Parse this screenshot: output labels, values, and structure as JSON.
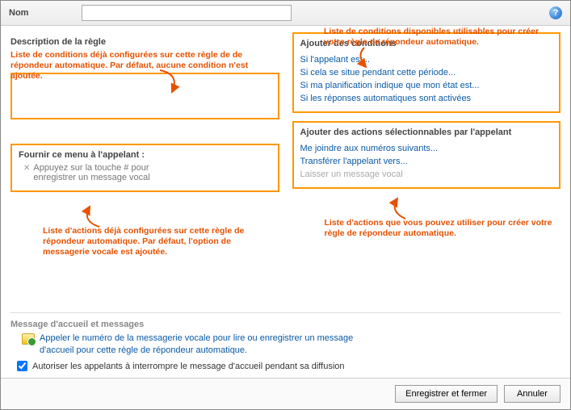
{
  "header": {
    "name_label": "Nom",
    "name_value": ""
  },
  "annotations": {
    "top_right": "Liste de conditions disponibles utilisables pour créer votre règle de répondeur automatique.",
    "left_conditions": "Liste de conditions déjà configurées sur cette règle de de répondeur automatique. Par défaut, aucune condition n'est ajoutée.",
    "left_actions": "Liste d'actions déjà configurées sur cette règle de répondeur automatique. Par défaut, l'option de messagerie vocale est ajoutée.",
    "right_actions": "Liste d'actions que vous pouvez utiliser pour créer votre règle de répondeur automatique."
  },
  "left": {
    "description_title": "Description de la règle",
    "menu_title": "Fournir ce menu à l'appelant :",
    "menu_item": "Appuyez sur la touche # pour enregistrer un message vocal"
  },
  "right": {
    "conditions_title": "Ajouter des conditions",
    "conditions": [
      "Si l'appelant est...",
      "Si cela se situe pendant cette période...",
      "Si ma planification indique que mon état est...",
      "Si les réponses automatiques sont activées"
    ],
    "actions_title": "Ajouter des actions sélectionnables par l'appelant",
    "actions": [
      {
        "label": "Me joindre aux numéros suivants...",
        "enabled": true
      },
      {
        "label": "Transférer l'appelant vers...",
        "enabled": true
      },
      {
        "label": "Laisser un message vocal",
        "enabled": false
      }
    ]
  },
  "bottom": {
    "title": "Message d'accueil et messages",
    "link": "Appeler le numéro de la messagerie vocale pour lire ou enregistrer un message d'accueil pour cette règle de répondeur automatique.",
    "checkbox_label": "Autoriser les appelants à interrompre le message d'accueil pendant sa diffusion",
    "checkbox_checked": true
  },
  "footer": {
    "save": "Enregistrer et fermer",
    "cancel": "Annuler"
  }
}
